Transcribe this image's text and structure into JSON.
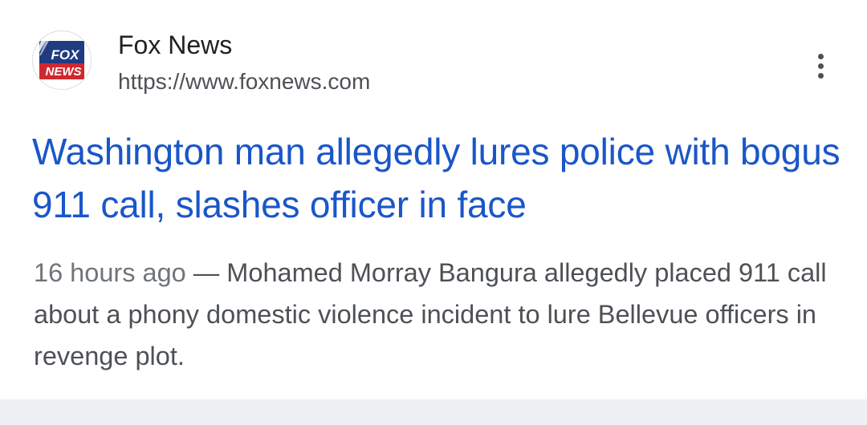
{
  "result": {
    "source": {
      "name": "Fox News",
      "url": "https://www.foxnews.com",
      "logo_top": "FOX",
      "logo_bottom": "NEWS",
      "logo_colors": {
        "navy": "#1f3c82",
        "red": "#d0282f"
      }
    },
    "menu_icon": "more-vert-icon",
    "headline": "Washington man allegedly lures police with bogus 911 call, slashes officer in face",
    "snippet": {
      "time": "16 hours ago",
      "separator": " — ",
      "text": "Mohamed Morray Bangura allegedly placed 911 call about a phony domestic violence incident to lure Bellevue officers in revenge plot."
    }
  },
  "colors": {
    "link": "#1a56c9",
    "title_text": "#202124",
    "secondary_text": "#4d5156",
    "background": "#ffffff",
    "footer_band": "#eef0f3"
  }
}
